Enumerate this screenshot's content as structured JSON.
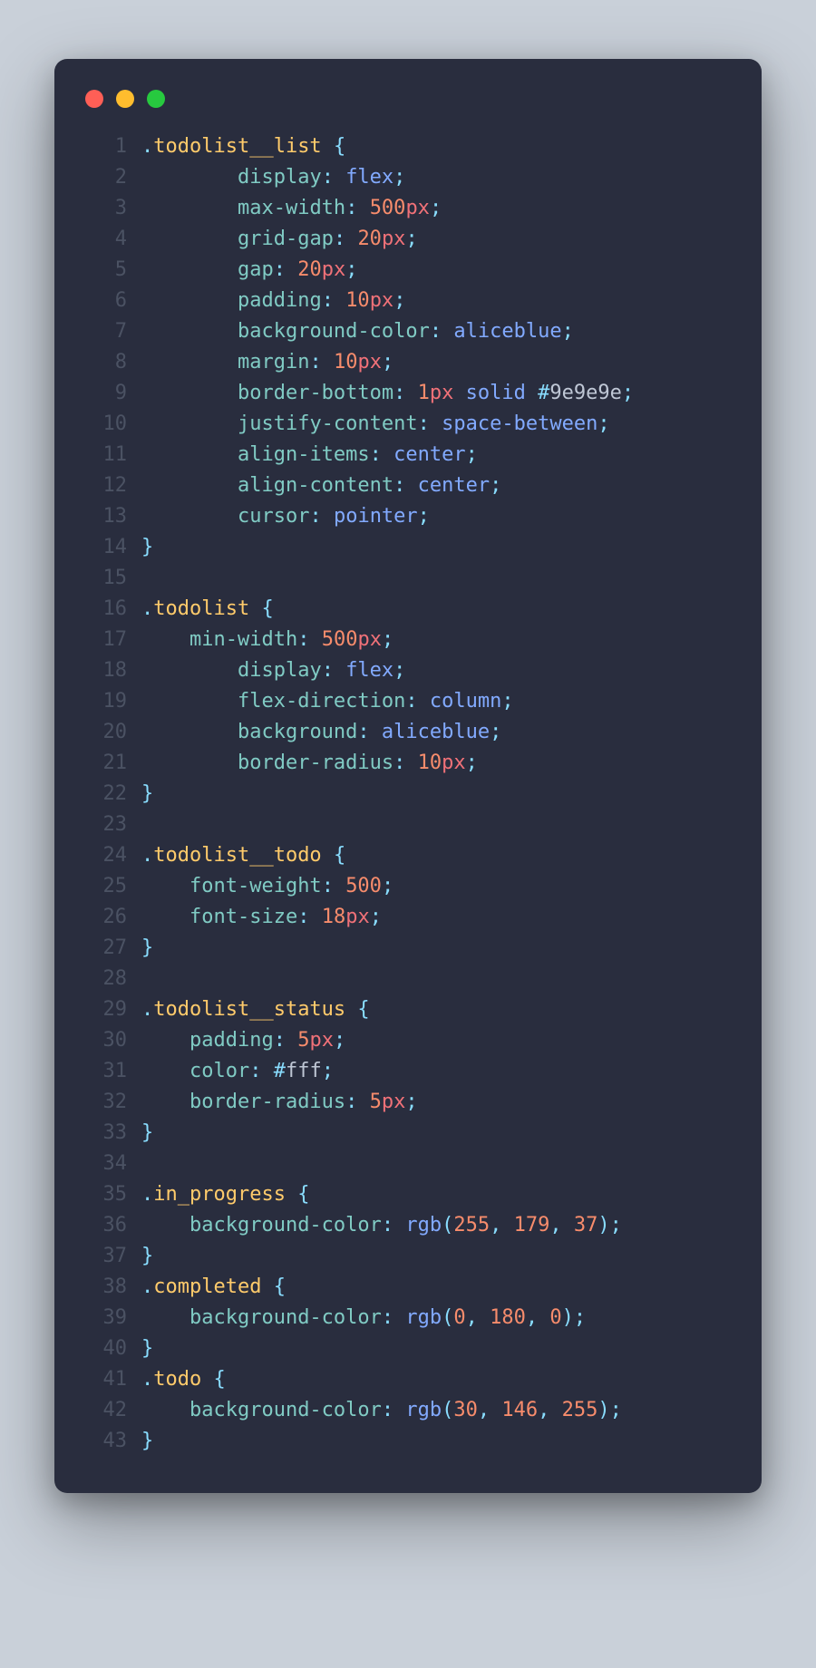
{
  "window": {
    "controls": [
      "close",
      "minimize",
      "zoom"
    ]
  },
  "code": {
    "language": "css",
    "lines": [
      {
        "n": 1,
        "indent": 0,
        "tokens": [
          [
            "punct",
            "."
          ],
          [
            "selector",
            "todolist__list"
          ],
          [
            "ws",
            " "
          ],
          [
            "punct",
            "{"
          ]
        ]
      },
      {
        "n": 2,
        "indent": 8,
        "tokens": [
          [
            "prop",
            "display"
          ],
          [
            "punct",
            ":"
          ],
          [
            "ws",
            " "
          ],
          [
            "value",
            "flex"
          ],
          [
            "punct",
            ";"
          ]
        ]
      },
      {
        "n": 3,
        "indent": 8,
        "tokens": [
          [
            "prop",
            "max-width"
          ],
          [
            "punct",
            ":"
          ],
          [
            "ws",
            " "
          ],
          [
            "num",
            "500"
          ],
          [
            "unit",
            "px"
          ],
          [
            "punct",
            ";"
          ]
        ]
      },
      {
        "n": 4,
        "indent": 8,
        "tokens": [
          [
            "prop",
            "grid-gap"
          ],
          [
            "punct",
            ":"
          ],
          [
            "ws",
            " "
          ],
          [
            "num",
            "20"
          ],
          [
            "unit",
            "px"
          ],
          [
            "punct",
            ";"
          ]
        ]
      },
      {
        "n": 5,
        "indent": 8,
        "tokens": [
          [
            "prop",
            "gap"
          ],
          [
            "punct",
            ":"
          ],
          [
            "ws",
            " "
          ],
          [
            "num",
            "20"
          ],
          [
            "unit",
            "px"
          ],
          [
            "punct",
            ";"
          ]
        ]
      },
      {
        "n": 6,
        "indent": 8,
        "tokens": [
          [
            "prop",
            "padding"
          ],
          [
            "punct",
            ":"
          ],
          [
            "ws",
            " "
          ],
          [
            "num",
            "10"
          ],
          [
            "unit",
            "px"
          ],
          [
            "punct",
            ";"
          ]
        ]
      },
      {
        "n": 7,
        "indent": 8,
        "tokens": [
          [
            "prop",
            "background-color"
          ],
          [
            "punct",
            ":"
          ],
          [
            "ws",
            " "
          ],
          [
            "value",
            "aliceblue"
          ],
          [
            "punct",
            ";"
          ]
        ]
      },
      {
        "n": 8,
        "indent": 8,
        "tokens": [
          [
            "prop",
            "margin"
          ],
          [
            "punct",
            ":"
          ],
          [
            "ws",
            " "
          ],
          [
            "num",
            "10"
          ],
          [
            "unit",
            "px"
          ],
          [
            "punct",
            ";"
          ]
        ]
      },
      {
        "n": 9,
        "indent": 8,
        "tokens": [
          [
            "prop",
            "border-bottom"
          ],
          [
            "punct",
            ":"
          ],
          [
            "ws",
            " "
          ],
          [
            "num",
            "1"
          ],
          [
            "unit",
            "px"
          ],
          [
            "ws",
            " "
          ],
          [
            "value",
            "solid"
          ],
          [
            "ws",
            " "
          ],
          [
            "hash",
            "#"
          ],
          [
            "hex",
            "9e9e9e"
          ],
          [
            "punct",
            ";"
          ]
        ]
      },
      {
        "n": 10,
        "indent": 8,
        "tokens": [
          [
            "prop",
            "justify-content"
          ],
          [
            "punct",
            ":"
          ],
          [
            "ws",
            " "
          ],
          [
            "value",
            "space-between"
          ],
          [
            "punct",
            ";"
          ]
        ]
      },
      {
        "n": 11,
        "indent": 8,
        "tokens": [
          [
            "prop",
            "align-items"
          ],
          [
            "punct",
            ":"
          ],
          [
            "ws",
            " "
          ],
          [
            "value",
            "center"
          ],
          [
            "punct",
            ";"
          ]
        ]
      },
      {
        "n": 12,
        "indent": 8,
        "tokens": [
          [
            "prop",
            "align-content"
          ],
          [
            "punct",
            ":"
          ],
          [
            "ws",
            " "
          ],
          [
            "value",
            "center"
          ],
          [
            "punct",
            ";"
          ]
        ]
      },
      {
        "n": 13,
        "indent": 8,
        "tokens": [
          [
            "prop",
            "cursor"
          ],
          [
            "punct",
            ":"
          ],
          [
            "ws",
            " "
          ],
          [
            "value",
            "pointer"
          ],
          [
            "punct",
            ";"
          ]
        ]
      },
      {
        "n": 14,
        "indent": 0,
        "tokens": [
          [
            "punct",
            "}"
          ]
        ]
      },
      {
        "n": 15,
        "indent": 0,
        "tokens": []
      },
      {
        "n": 16,
        "indent": 0,
        "tokens": [
          [
            "punct",
            "."
          ],
          [
            "selector",
            "todolist"
          ],
          [
            "ws",
            " "
          ],
          [
            "punct",
            "{"
          ]
        ]
      },
      {
        "n": 17,
        "indent": 4,
        "tokens": [
          [
            "prop",
            "min-width"
          ],
          [
            "punct",
            ":"
          ],
          [
            "ws",
            " "
          ],
          [
            "num",
            "500"
          ],
          [
            "unit",
            "px"
          ],
          [
            "punct",
            ";"
          ]
        ]
      },
      {
        "n": 18,
        "indent": 8,
        "tokens": [
          [
            "prop",
            "display"
          ],
          [
            "punct",
            ":"
          ],
          [
            "ws",
            " "
          ],
          [
            "value",
            "flex"
          ],
          [
            "punct",
            ";"
          ]
        ]
      },
      {
        "n": 19,
        "indent": 8,
        "tokens": [
          [
            "prop",
            "flex-direction"
          ],
          [
            "punct",
            ":"
          ],
          [
            "ws",
            " "
          ],
          [
            "value",
            "column"
          ],
          [
            "punct",
            ";"
          ]
        ]
      },
      {
        "n": 20,
        "indent": 8,
        "tokens": [
          [
            "prop",
            "background"
          ],
          [
            "punct",
            ":"
          ],
          [
            "ws",
            " "
          ],
          [
            "value",
            "aliceblue"
          ],
          [
            "punct",
            ";"
          ]
        ]
      },
      {
        "n": 21,
        "indent": 8,
        "tokens": [
          [
            "prop",
            "border-radius"
          ],
          [
            "punct",
            ":"
          ],
          [
            "ws",
            " "
          ],
          [
            "num",
            "10"
          ],
          [
            "unit",
            "px"
          ],
          [
            "punct",
            ";"
          ]
        ]
      },
      {
        "n": 22,
        "indent": 0,
        "tokens": [
          [
            "punct",
            "}"
          ]
        ]
      },
      {
        "n": 23,
        "indent": 0,
        "tokens": []
      },
      {
        "n": 24,
        "indent": 0,
        "tokens": [
          [
            "punct",
            "."
          ],
          [
            "selector",
            "todolist__todo"
          ],
          [
            "ws",
            " "
          ],
          [
            "punct",
            "{"
          ]
        ]
      },
      {
        "n": 25,
        "indent": 4,
        "tokens": [
          [
            "prop",
            "font-weight"
          ],
          [
            "punct",
            ":"
          ],
          [
            "ws",
            " "
          ],
          [
            "num",
            "500"
          ],
          [
            "punct",
            ";"
          ]
        ]
      },
      {
        "n": 26,
        "indent": 4,
        "tokens": [
          [
            "prop",
            "font-size"
          ],
          [
            "punct",
            ":"
          ],
          [
            "ws",
            " "
          ],
          [
            "num",
            "18"
          ],
          [
            "unit",
            "px"
          ],
          [
            "punct",
            ";"
          ]
        ]
      },
      {
        "n": 27,
        "indent": 0,
        "tokens": [
          [
            "punct",
            "}"
          ]
        ]
      },
      {
        "n": 28,
        "indent": 0,
        "tokens": []
      },
      {
        "n": 29,
        "indent": 0,
        "tokens": [
          [
            "punct",
            "."
          ],
          [
            "selector",
            "todolist__status"
          ],
          [
            "ws",
            " "
          ],
          [
            "punct",
            "{"
          ]
        ]
      },
      {
        "n": 30,
        "indent": 4,
        "tokens": [
          [
            "prop",
            "padding"
          ],
          [
            "punct",
            ":"
          ],
          [
            "ws",
            " "
          ],
          [
            "num",
            "5"
          ],
          [
            "unit",
            "px"
          ],
          [
            "punct",
            ";"
          ]
        ]
      },
      {
        "n": 31,
        "indent": 4,
        "tokens": [
          [
            "prop",
            "color"
          ],
          [
            "punct",
            ":"
          ],
          [
            "ws",
            " "
          ],
          [
            "hash",
            "#"
          ],
          [
            "hex",
            "fff"
          ],
          [
            "punct",
            ";"
          ]
        ]
      },
      {
        "n": 32,
        "indent": 4,
        "tokens": [
          [
            "prop",
            "border-radius"
          ],
          [
            "punct",
            ":"
          ],
          [
            "ws",
            " "
          ],
          [
            "num",
            "5"
          ],
          [
            "unit",
            "px"
          ],
          [
            "punct",
            ";"
          ]
        ]
      },
      {
        "n": 33,
        "indent": 0,
        "tokens": [
          [
            "punct",
            "}"
          ]
        ]
      },
      {
        "n": 34,
        "indent": 0,
        "tokens": []
      },
      {
        "n": 35,
        "indent": 0,
        "tokens": [
          [
            "punct",
            "."
          ],
          [
            "selector",
            "in_progress"
          ],
          [
            "ws",
            " "
          ],
          [
            "punct",
            "{"
          ]
        ]
      },
      {
        "n": 36,
        "indent": 4,
        "tokens": [
          [
            "prop",
            "background-color"
          ],
          [
            "punct",
            ":"
          ],
          [
            "ws",
            " "
          ],
          [
            "func",
            "rgb"
          ],
          [
            "punct",
            "("
          ],
          [
            "num",
            "255"
          ],
          [
            "punct",
            ","
          ],
          [
            "ws",
            " "
          ],
          [
            "num",
            "179"
          ],
          [
            "punct",
            ","
          ],
          [
            "ws",
            " "
          ],
          [
            "num",
            "37"
          ],
          [
            "punct",
            ")"
          ],
          [
            "punct",
            ";"
          ]
        ]
      },
      {
        "n": 37,
        "indent": 0,
        "tokens": [
          [
            "punct",
            "}"
          ]
        ]
      },
      {
        "n": 38,
        "indent": 0,
        "tokens": [
          [
            "punct",
            "."
          ],
          [
            "selector",
            "completed"
          ],
          [
            "ws",
            " "
          ],
          [
            "punct",
            "{"
          ]
        ]
      },
      {
        "n": 39,
        "indent": 4,
        "tokens": [
          [
            "prop",
            "background-color"
          ],
          [
            "punct",
            ":"
          ],
          [
            "ws",
            " "
          ],
          [
            "func",
            "rgb"
          ],
          [
            "punct",
            "("
          ],
          [
            "num",
            "0"
          ],
          [
            "punct",
            ","
          ],
          [
            "ws",
            " "
          ],
          [
            "num",
            "180"
          ],
          [
            "punct",
            ","
          ],
          [
            "ws",
            " "
          ],
          [
            "num",
            "0"
          ],
          [
            "punct",
            ")"
          ],
          [
            "punct",
            ";"
          ]
        ]
      },
      {
        "n": 40,
        "indent": 0,
        "tokens": [
          [
            "punct",
            "}"
          ]
        ]
      },
      {
        "n": 41,
        "indent": 0,
        "tokens": [
          [
            "punct",
            "."
          ],
          [
            "selector",
            "todo"
          ],
          [
            "ws",
            " "
          ],
          [
            "punct",
            "{"
          ]
        ]
      },
      {
        "n": 42,
        "indent": 4,
        "tokens": [
          [
            "prop",
            "background-color"
          ],
          [
            "punct",
            ":"
          ],
          [
            "ws",
            " "
          ],
          [
            "func",
            "rgb"
          ],
          [
            "punct",
            "("
          ],
          [
            "num",
            "30"
          ],
          [
            "punct",
            ","
          ],
          [
            "ws",
            " "
          ],
          [
            "num",
            "146"
          ],
          [
            "punct",
            ","
          ],
          [
            "ws",
            " "
          ],
          [
            "num",
            "255"
          ],
          [
            "punct",
            ")"
          ],
          [
            "punct",
            ";"
          ]
        ]
      },
      {
        "n": 43,
        "indent": 0,
        "tokens": [
          [
            "punct",
            "}"
          ]
        ]
      }
    ]
  }
}
